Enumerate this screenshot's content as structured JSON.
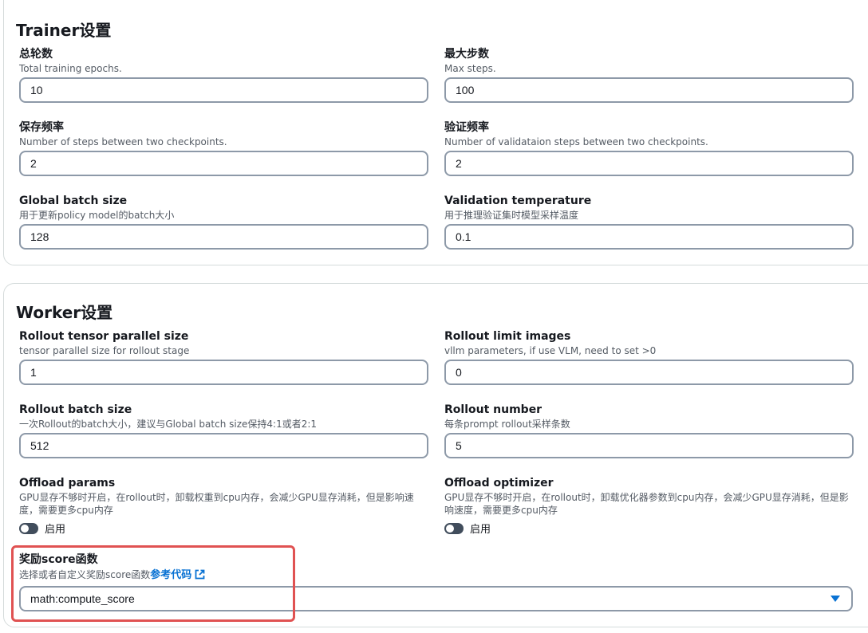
{
  "trainer": {
    "title": "Trainer设置",
    "fields": [
      {
        "label": "总轮数",
        "desc": "Total training epochs.",
        "value": "10"
      },
      {
        "label": "最大步数",
        "desc": "Max steps.",
        "value": "100"
      },
      {
        "label": "保存频率",
        "desc": "Number of steps between two checkpoints.",
        "value": "2"
      },
      {
        "label": "验证频率",
        "desc": "Number of validataion steps between two checkpoints.",
        "value": "2"
      },
      {
        "label": "Global batch size",
        "desc": "用于更新policy model的batch大小",
        "value": "128"
      },
      {
        "label": "Validation temperature",
        "desc": "用于推理验证集时模型采样温度",
        "value": "0.1"
      }
    ]
  },
  "worker": {
    "title": "Worker设置",
    "fields": [
      {
        "label": "Rollout tensor parallel size",
        "desc": "tensor parallel size for rollout stage",
        "value": "1"
      },
      {
        "label": "Rollout limit images",
        "desc": "vllm parameters, if use VLM, need to set >0",
        "value": "0"
      },
      {
        "label": "Rollout batch size",
        "desc": "一次Rollout的batch大小，建议与Global batch size保持4:1或者2:1",
        "value": "512"
      },
      {
        "label": "Rollout number",
        "desc": "每条prompt rollout采样条数",
        "value": "5"
      }
    ],
    "offload_params": {
      "label": "Offload params",
      "desc_line1": "GPU显存不够时开启，在rollout时，卸载权重到cpu内存，会减少GPU显存消耗，但是影响速度，需要更多cpu内存",
      "toggle_label": "启用"
    },
    "offload_optimizer": {
      "label": "Offload optimizer",
      "desc_line1": "GPU显存不够时开启，在rollout时，卸载优化器参数到cpu内存，会减少GPU显存消耗，但是影响速度，需要更多cpu内存",
      "toggle_label": "启用"
    },
    "reward": {
      "label": "奖励score函数",
      "desc": "选择或者自定义奖励score函数",
      "link_text": "参考代码",
      "selected": "math:compute_score"
    }
  },
  "colors": {
    "link": "#0972d3",
    "highlight": "#e05252",
    "toggle_off": "#414d5c"
  }
}
